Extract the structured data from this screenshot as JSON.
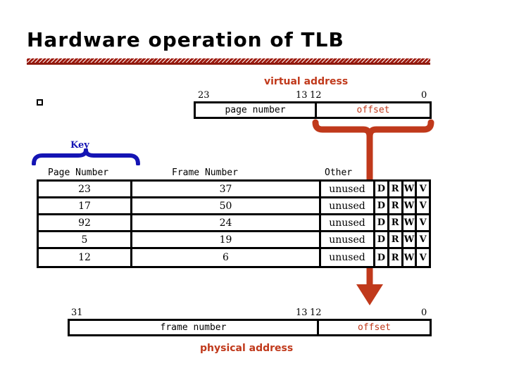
{
  "slide": {
    "title": "Hardware operation of TLB",
    "bullet_glyph": "square-bullet"
  },
  "virtual_address": {
    "caption": "virtual address",
    "bits": {
      "high": "23",
      "mid_left": "13",
      "mid_right": "12",
      "low": "0"
    },
    "segments": {
      "left": "page number",
      "right": "offset"
    }
  },
  "key": {
    "label": "Key"
  },
  "tlb_table": {
    "headers": {
      "page_number": "Page Number",
      "frame_number": "Frame Number",
      "other": "Other"
    },
    "flag_labels": [
      "D",
      "R",
      "W",
      "V"
    ],
    "rows": [
      {
        "page_number": "23",
        "frame_number": "37",
        "other": "unused",
        "flags": [
          "D",
          "R",
          "W",
          "V"
        ]
      },
      {
        "page_number": "17",
        "frame_number": "50",
        "other": "unused",
        "flags": [
          "D",
          "R",
          "W",
          "V"
        ]
      },
      {
        "page_number": "92",
        "frame_number": "24",
        "other": "unused",
        "flags": [
          "D",
          "R",
          "W",
          "V"
        ]
      },
      {
        "page_number": "5",
        "frame_number": "19",
        "other": "unused",
        "flags": [
          "D",
          "R",
          "W",
          "V"
        ]
      },
      {
        "page_number": "12",
        "frame_number": "6",
        "other": "unused",
        "flags": [
          "D",
          "R",
          "W",
          "V"
        ]
      }
    ]
  },
  "physical_address": {
    "caption": "physical address",
    "bits": {
      "high": "31",
      "mid_left": "13",
      "mid_right": "12",
      "low": "0"
    },
    "segments": {
      "left": "frame number",
      "right": "offset"
    }
  },
  "colors": {
    "accent_orange": "#c0391b",
    "rule_dark_red": "#9e1b0f",
    "key_blue": "#1414b4",
    "text_black": "#000000"
  }
}
